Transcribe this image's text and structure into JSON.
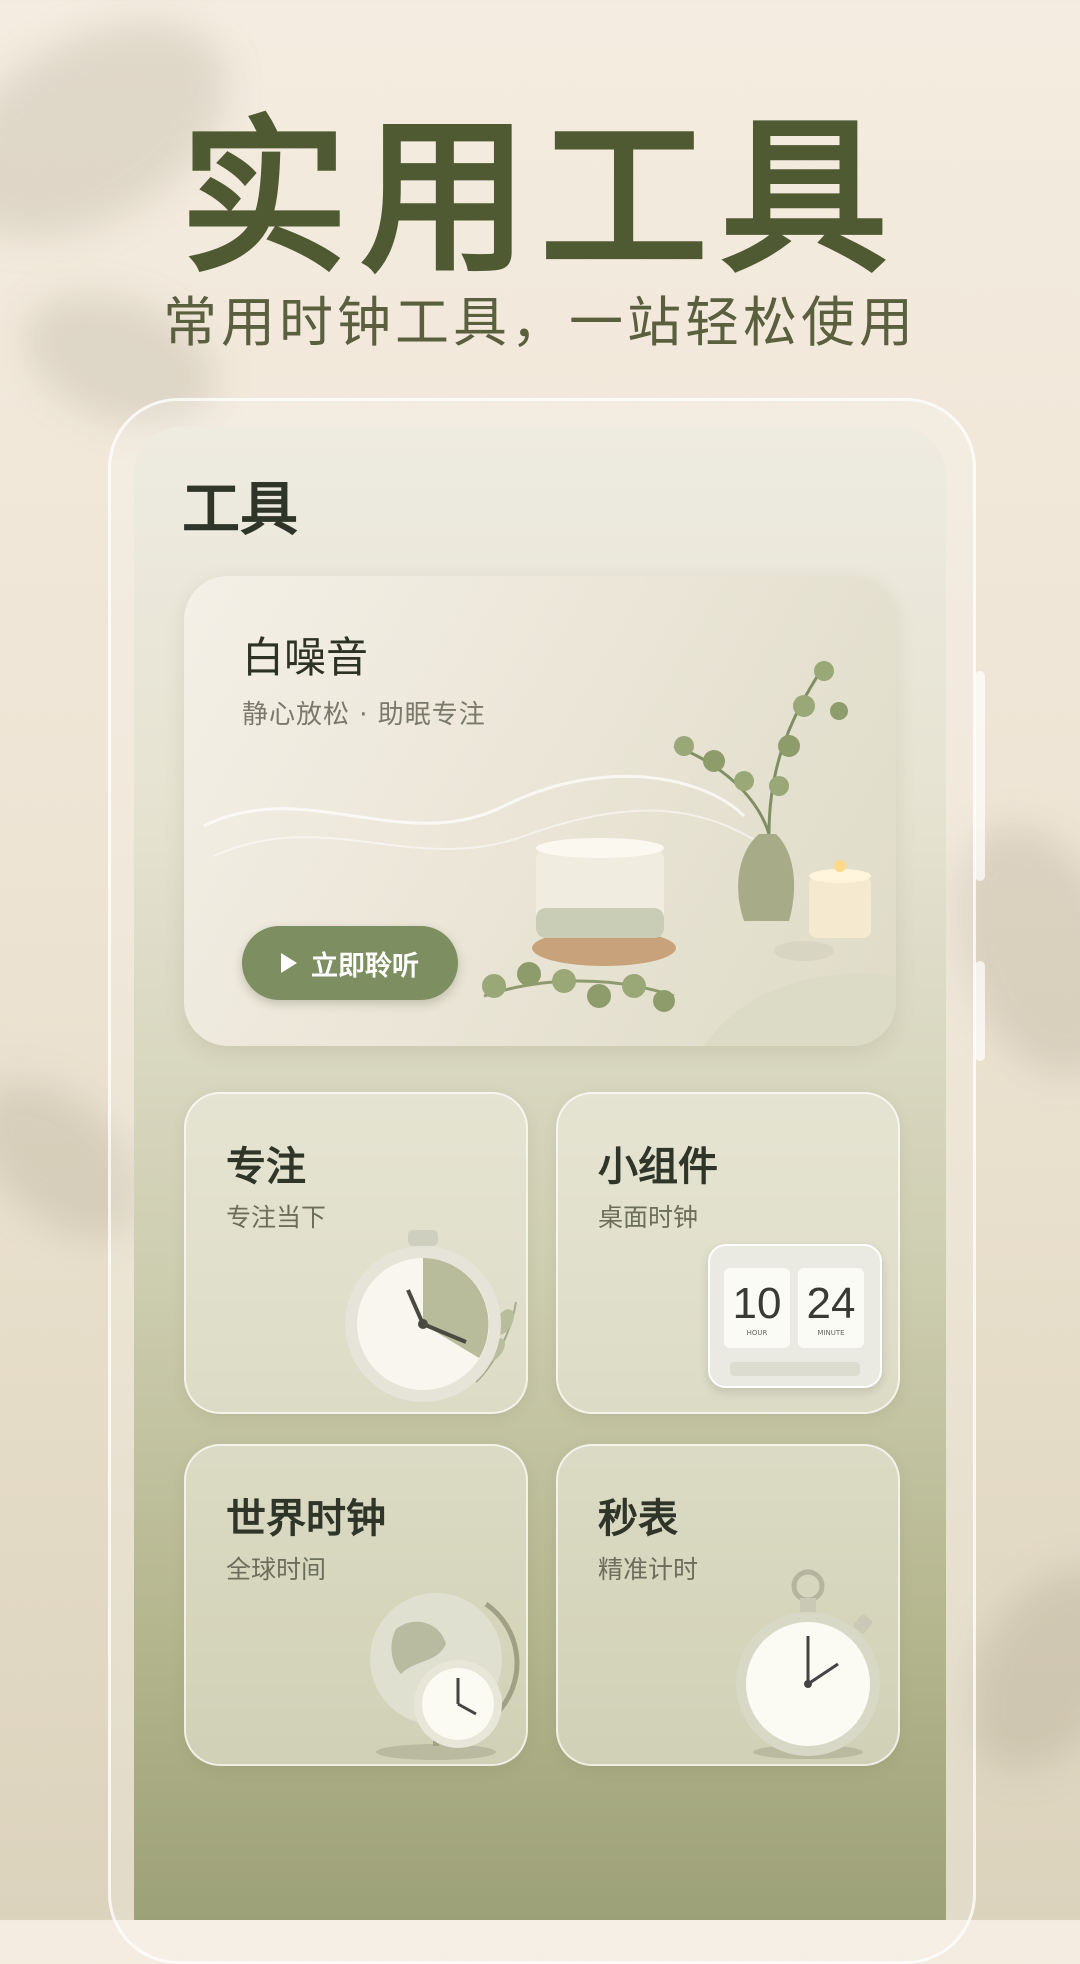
{
  "hero": {
    "title": "实用工具",
    "subtitle": "常用时钟工具，一站轻松使用"
  },
  "screen": {
    "title": "工具",
    "banner": {
      "title": "白噪音",
      "subtitle": "静心放松 · 助眠专注",
      "button_label": "立即聆听"
    },
    "tiles": [
      {
        "title": "专注",
        "subtitle": "专注当下"
      },
      {
        "title": "小组件",
        "subtitle": "桌面时钟",
        "flip_hour": "10",
        "flip_minute": "24",
        "hour_caption": "HOUR",
        "minute_caption": "MINUTE"
      },
      {
        "title": "世界时钟",
        "subtitle": "全球时间"
      },
      {
        "title": "秒表",
        "subtitle": "精准计时"
      }
    ]
  },
  "colors": {
    "title_green": "#4f5a33",
    "button_green": "#7d8e60",
    "text_dark": "#2f3528"
  }
}
